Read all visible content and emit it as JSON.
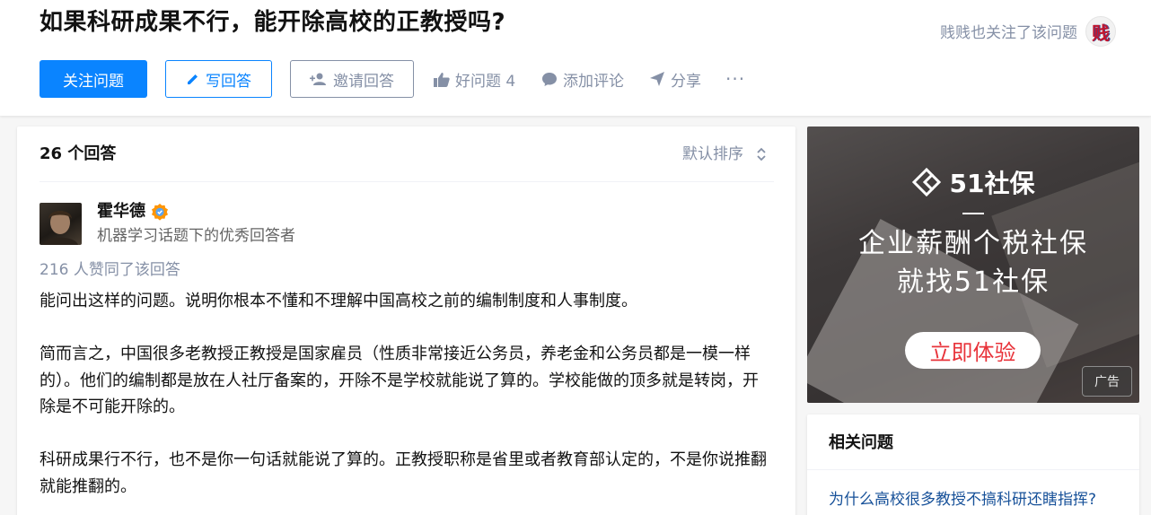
{
  "question": {
    "title": "如果科研成果不行，能开除高校的正教授吗?",
    "follow_status": "贱贱也关注了该问题",
    "follower_avatar_char": "贱"
  },
  "actions": {
    "follow_label": "关注问题",
    "write_label": "写回答",
    "invite_label": "邀请回答",
    "good_label": "好问题 4",
    "comment_label": "添加评论",
    "share_label": "分享",
    "more_label": "···"
  },
  "answers": {
    "count_label": "26 个回答",
    "sort_label": "默认排序",
    "items": [
      {
        "author": "霍华德",
        "headline": "机器学习话题下的优秀回答者",
        "votes": "216 人赞同了该回答",
        "paragraphs": [
          "能问出这样的问题。说明你根本不懂和不理解中国高校之前的编制制度和人事制度。",
          "简而言之，中国很多老教授正教授是国家雇员（性质非常接近公务员，养老金和公务员都是一模一样的）。他们的编制都是放在人社厅备案的，开除不是学校就能说了算的。学校能做的顶多就是转岗，开除是不可能开除的。",
          "科研成果行不行，也不是你一句话就能说了算的。正教授职称是省里或者教育部认定的，不是你说推翻就能推翻的。"
        ]
      }
    ]
  },
  "ad": {
    "logo_text": "51社保",
    "line1": "企业薪酬个税社保",
    "line2": "就找51社保",
    "cta": "立即体验",
    "tag": "广告"
  },
  "related": {
    "title": "相关问题",
    "items": [
      "为什么高校很多教授不搞科研还瞎指挥?"
    ]
  },
  "colors": {
    "brand": "#0a84ff",
    "muted": "#8590a6",
    "link": "#175199",
    "ad_cta_text": "#e8333a"
  }
}
